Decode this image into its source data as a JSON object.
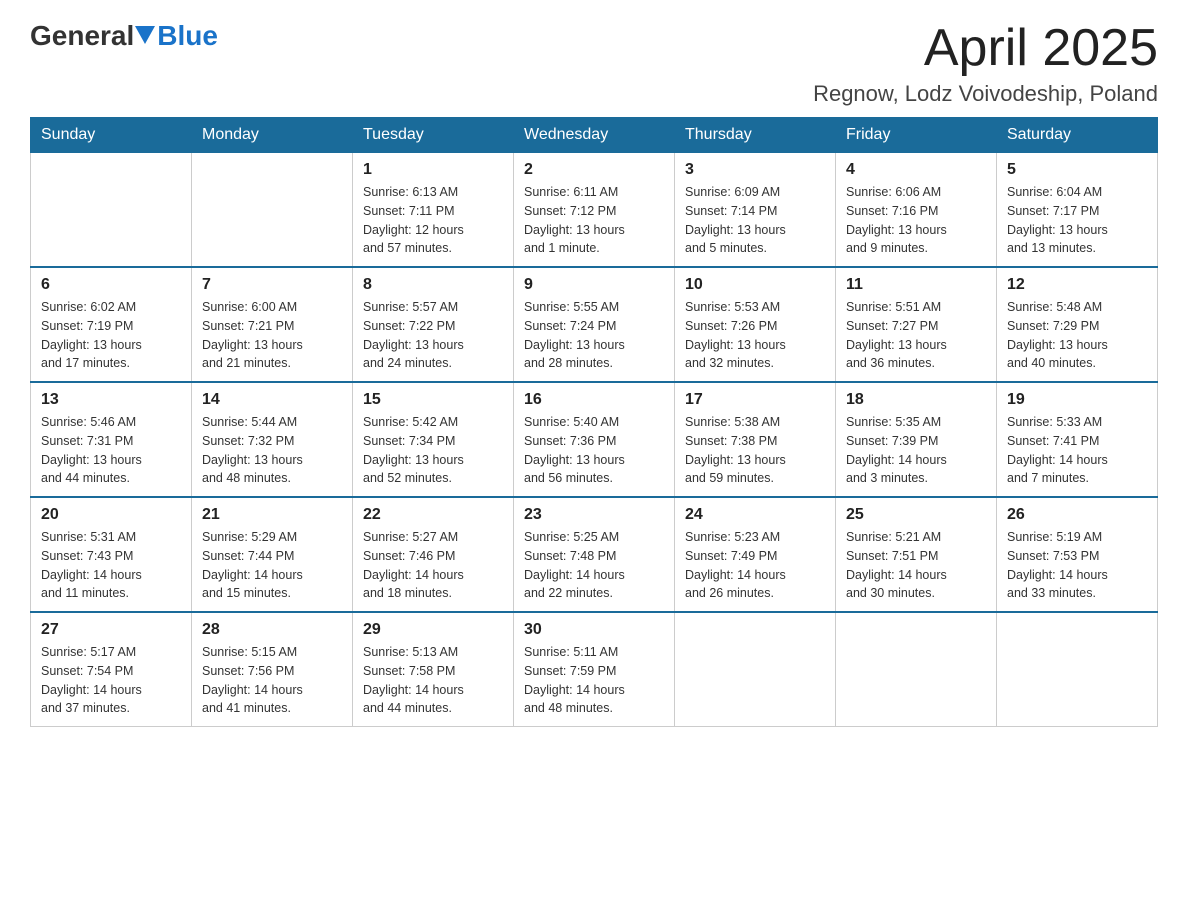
{
  "header": {
    "logo": {
      "general": "General",
      "blue": "Blue"
    },
    "title": "April 2025",
    "location": "Regnow, Lodz Voivodeship, Poland"
  },
  "weekdays": [
    "Sunday",
    "Monday",
    "Tuesday",
    "Wednesday",
    "Thursday",
    "Friday",
    "Saturday"
  ],
  "weeks": [
    [
      {
        "day": "",
        "info": ""
      },
      {
        "day": "",
        "info": ""
      },
      {
        "day": "1",
        "info": "Sunrise: 6:13 AM\nSunset: 7:11 PM\nDaylight: 12 hours\nand 57 minutes."
      },
      {
        "day": "2",
        "info": "Sunrise: 6:11 AM\nSunset: 7:12 PM\nDaylight: 13 hours\nand 1 minute."
      },
      {
        "day": "3",
        "info": "Sunrise: 6:09 AM\nSunset: 7:14 PM\nDaylight: 13 hours\nand 5 minutes."
      },
      {
        "day": "4",
        "info": "Sunrise: 6:06 AM\nSunset: 7:16 PM\nDaylight: 13 hours\nand 9 minutes."
      },
      {
        "day": "5",
        "info": "Sunrise: 6:04 AM\nSunset: 7:17 PM\nDaylight: 13 hours\nand 13 minutes."
      }
    ],
    [
      {
        "day": "6",
        "info": "Sunrise: 6:02 AM\nSunset: 7:19 PM\nDaylight: 13 hours\nand 17 minutes."
      },
      {
        "day": "7",
        "info": "Sunrise: 6:00 AM\nSunset: 7:21 PM\nDaylight: 13 hours\nand 21 minutes."
      },
      {
        "day": "8",
        "info": "Sunrise: 5:57 AM\nSunset: 7:22 PM\nDaylight: 13 hours\nand 24 minutes."
      },
      {
        "day": "9",
        "info": "Sunrise: 5:55 AM\nSunset: 7:24 PM\nDaylight: 13 hours\nand 28 minutes."
      },
      {
        "day": "10",
        "info": "Sunrise: 5:53 AM\nSunset: 7:26 PM\nDaylight: 13 hours\nand 32 minutes."
      },
      {
        "day": "11",
        "info": "Sunrise: 5:51 AM\nSunset: 7:27 PM\nDaylight: 13 hours\nand 36 minutes."
      },
      {
        "day": "12",
        "info": "Sunrise: 5:48 AM\nSunset: 7:29 PM\nDaylight: 13 hours\nand 40 minutes."
      }
    ],
    [
      {
        "day": "13",
        "info": "Sunrise: 5:46 AM\nSunset: 7:31 PM\nDaylight: 13 hours\nand 44 minutes."
      },
      {
        "day": "14",
        "info": "Sunrise: 5:44 AM\nSunset: 7:32 PM\nDaylight: 13 hours\nand 48 minutes."
      },
      {
        "day": "15",
        "info": "Sunrise: 5:42 AM\nSunset: 7:34 PM\nDaylight: 13 hours\nand 52 minutes."
      },
      {
        "day": "16",
        "info": "Sunrise: 5:40 AM\nSunset: 7:36 PM\nDaylight: 13 hours\nand 56 minutes."
      },
      {
        "day": "17",
        "info": "Sunrise: 5:38 AM\nSunset: 7:38 PM\nDaylight: 13 hours\nand 59 minutes."
      },
      {
        "day": "18",
        "info": "Sunrise: 5:35 AM\nSunset: 7:39 PM\nDaylight: 14 hours\nand 3 minutes."
      },
      {
        "day": "19",
        "info": "Sunrise: 5:33 AM\nSunset: 7:41 PM\nDaylight: 14 hours\nand 7 minutes."
      }
    ],
    [
      {
        "day": "20",
        "info": "Sunrise: 5:31 AM\nSunset: 7:43 PM\nDaylight: 14 hours\nand 11 minutes."
      },
      {
        "day": "21",
        "info": "Sunrise: 5:29 AM\nSunset: 7:44 PM\nDaylight: 14 hours\nand 15 minutes."
      },
      {
        "day": "22",
        "info": "Sunrise: 5:27 AM\nSunset: 7:46 PM\nDaylight: 14 hours\nand 18 minutes."
      },
      {
        "day": "23",
        "info": "Sunrise: 5:25 AM\nSunset: 7:48 PM\nDaylight: 14 hours\nand 22 minutes."
      },
      {
        "day": "24",
        "info": "Sunrise: 5:23 AM\nSunset: 7:49 PM\nDaylight: 14 hours\nand 26 minutes."
      },
      {
        "day": "25",
        "info": "Sunrise: 5:21 AM\nSunset: 7:51 PM\nDaylight: 14 hours\nand 30 minutes."
      },
      {
        "day": "26",
        "info": "Sunrise: 5:19 AM\nSunset: 7:53 PM\nDaylight: 14 hours\nand 33 minutes."
      }
    ],
    [
      {
        "day": "27",
        "info": "Sunrise: 5:17 AM\nSunset: 7:54 PM\nDaylight: 14 hours\nand 37 minutes."
      },
      {
        "day": "28",
        "info": "Sunrise: 5:15 AM\nSunset: 7:56 PM\nDaylight: 14 hours\nand 41 minutes."
      },
      {
        "day": "29",
        "info": "Sunrise: 5:13 AM\nSunset: 7:58 PM\nDaylight: 14 hours\nand 44 minutes."
      },
      {
        "day": "30",
        "info": "Sunrise: 5:11 AM\nSunset: 7:59 PM\nDaylight: 14 hours\nand 48 minutes."
      },
      {
        "day": "",
        "info": ""
      },
      {
        "day": "",
        "info": ""
      },
      {
        "day": "",
        "info": ""
      }
    ]
  ]
}
